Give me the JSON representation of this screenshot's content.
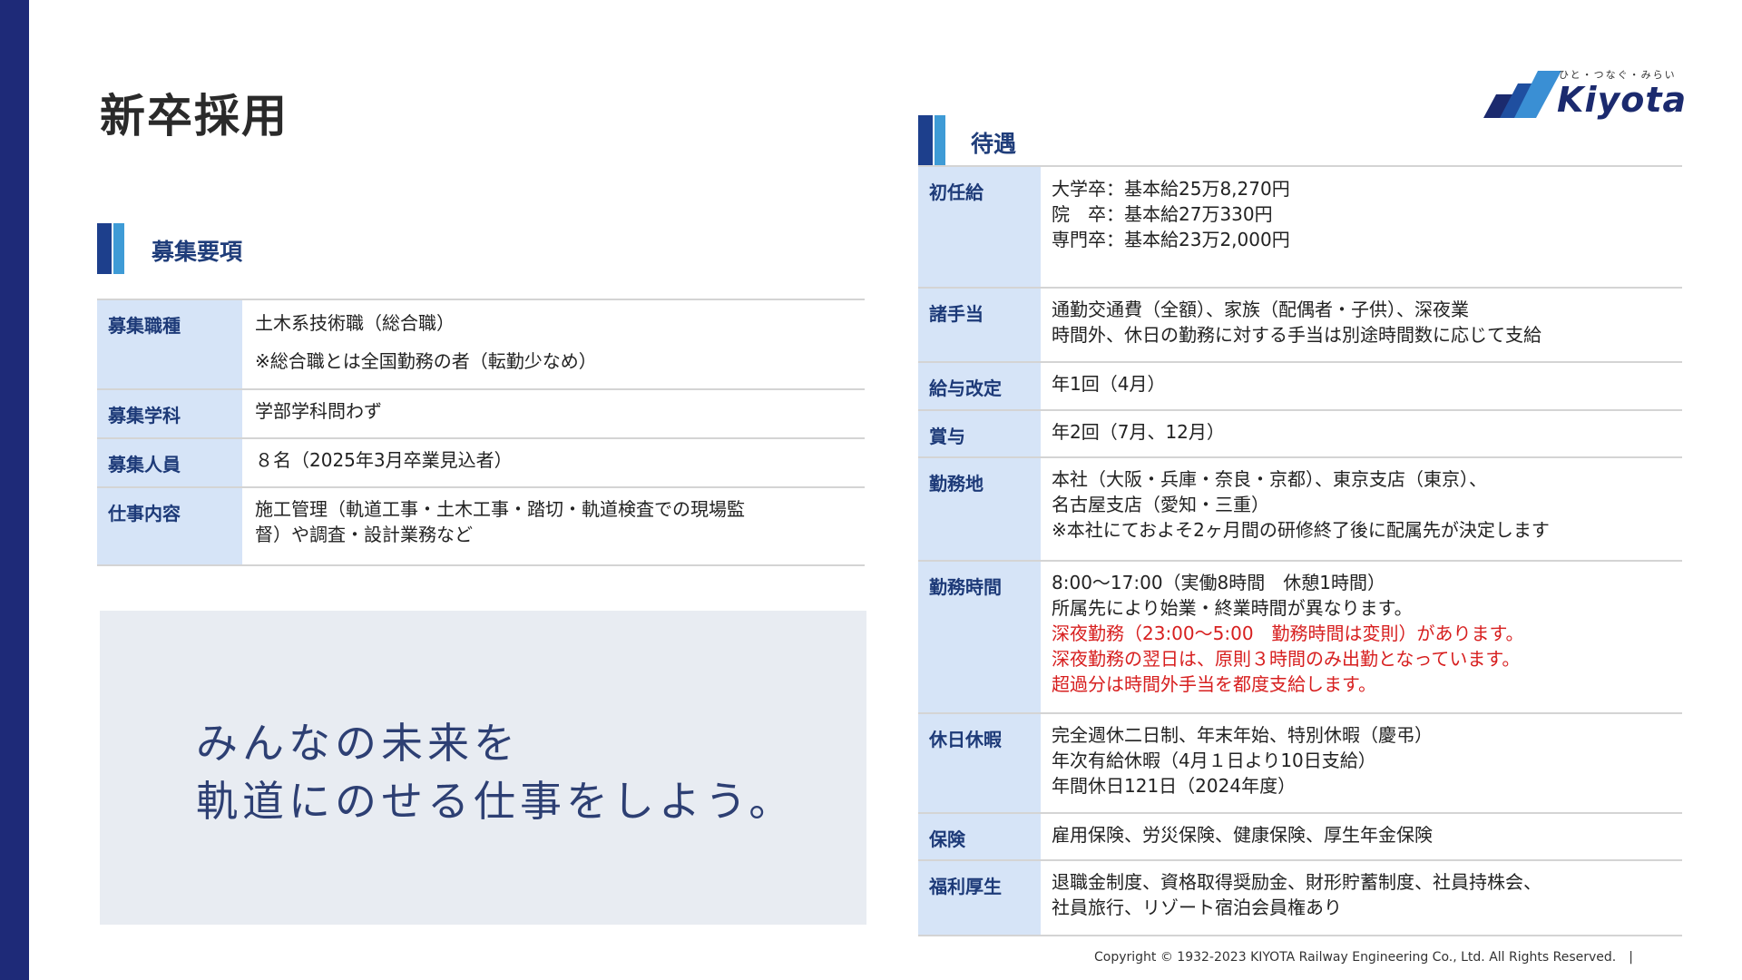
{
  "page": {
    "title": "新卒採用"
  },
  "logo": {
    "tagline": "ひと・つなぐ・みらい",
    "wordmark": "Kiyota"
  },
  "recruitment": {
    "heading": "募集要項",
    "rows": [
      {
        "label": "募集職種",
        "lines": [
          "土木系技術職（総合職）",
          "※総合職とは全国勤務の者（転勤少なめ）"
        ]
      },
      {
        "label": "募集学科",
        "lines": [
          "学部学科問わず"
        ]
      },
      {
        "label": "募集人員",
        "lines": [
          "８名（2025年3月卒業見込者）"
        ]
      },
      {
        "label": "仕事内容",
        "lines": [
          "施工管理（軌道工事・土木工事・踏切・軌道検査での現場監",
          "督）や調査・設計業務など"
        ]
      }
    ]
  },
  "slogan": {
    "line1": "みんなの未来を",
    "line2": "軌道にのせる仕事をしよう。"
  },
  "benefits": {
    "heading": "待遇",
    "rows": [
      {
        "label": "初任給",
        "lines": [
          "大学卒：基本給25万8,270円",
          "院　卒：基本給27万330円",
          "専門卒：基本給23万2,000円"
        ]
      },
      {
        "label": "諸手当",
        "lines": [
          "通勤交通費（全額）、家族（配偶者・子供）、深夜業",
          "時間外、休日の勤務に対する手当は別途時間数に応じて支給"
        ]
      },
      {
        "label": "給与改定",
        "lines": [
          "年1回（4月）"
        ]
      },
      {
        "label": "賞与",
        "lines": [
          "年2回（7月、12月）"
        ]
      },
      {
        "label": "勤務地",
        "lines": [
          "本社（大阪・兵庫・奈良・京都）、東京支店（東京）、",
          "名古屋支店（愛知・三重）",
          "※本社にておよそ2ヶ月間の研修終了後に配属先が決定します"
        ]
      },
      {
        "label": "勤務時間",
        "lines": [
          "8:00～17:00（実働8時間　休憩1時間）",
          "所属先により始業・終業時間が異なります。"
        ],
        "notes": [
          "深夜勤務（23:00～5:00　勤務時間は変則）があります。",
          "深夜勤務の翌日は、原則３時間のみ出勤となっています。",
          "超過分は時間外手当を都度支給します。"
        ]
      },
      {
        "label": "休日休暇",
        "lines": [
          "完全週休二日制、年末年始、特別休暇（慶弔）",
          "年次有給休暇（4月１日より10日支給）",
          "年間休日121日（2024年度）"
        ]
      },
      {
        "label": "保険",
        "lines": [
          "雇用保険、労災保険、健康保険、厚生年金保険"
        ]
      },
      {
        "label": "福利厚生",
        "lines": [
          "退職金制度、資格取得奨励金、財形貯蓄制度、社員持株会、",
          "社員旅行、リゾート宿泊会員権あり"
        ]
      }
    ]
  },
  "footer": {
    "copyright": "Copyright © 1932-2023 KIYOTA Railway Engineering Co., Ltd. All Rights Reserved.　|"
  },
  "colors": {
    "stripe": "#1e2a78",
    "accent_dark": "#1d3f8c",
    "accent_light": "#3e9bd6",
    "label_bg": "#d6e4f7",
    "warning_text": "#d71f1f"
  },
  "icons": {
    "logo_mark": "kiyota-parallelogram-mark"
  }
}
